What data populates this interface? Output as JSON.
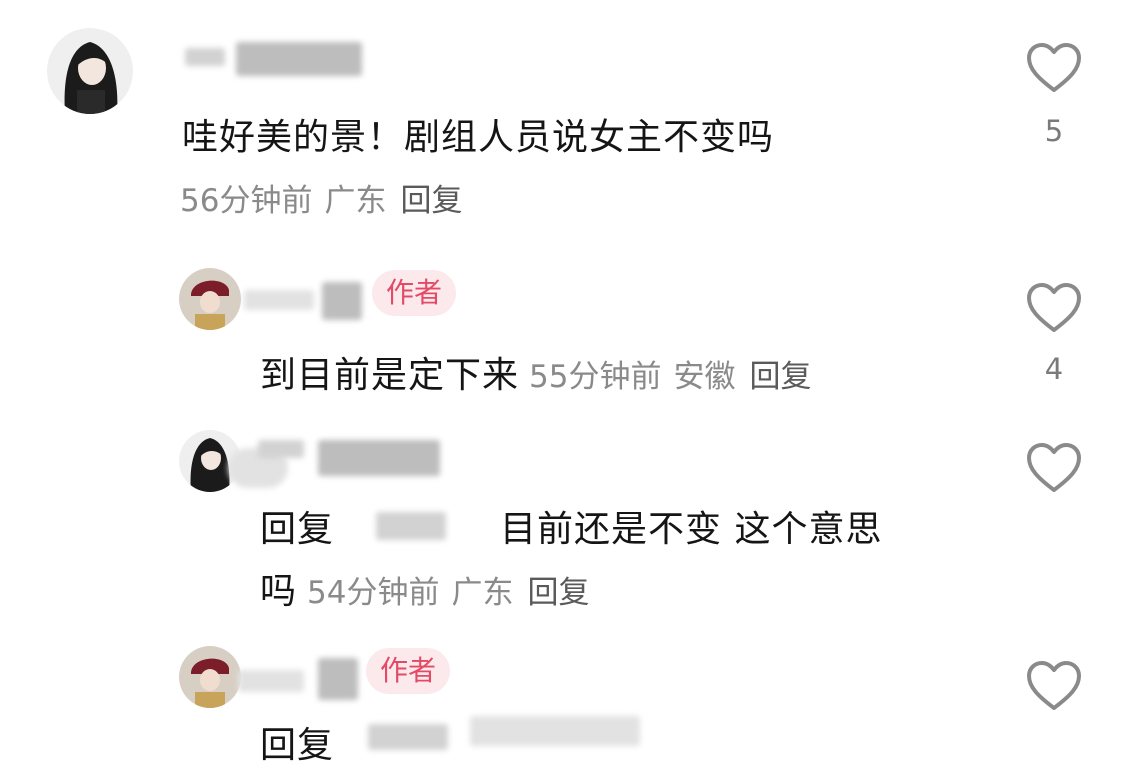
{
  "comments": [
    {
      "text": "哇好美的景！剧组人员说女主不变吗",
      "time": "56分钟前",
      "location": "广东",
      "reply_label": "回复",
      "likes": "5"
    },
    {
      "author_badge": "作者",
      "text": "到目前是定下来",
      "time": "55分钟前",
      "location": "安徽",
      "reply_label": "回复",
      "likes": "4"
    },
    {
      "reply_prefix": "回复",
      "text_line1": "目前还是不变 这个意思",
      "text_line2": "吗",
      "time": "54分钟前",
      "location": "广东",
      "reply_label": "回复"
    },
    {
      "author_badge": "作者",
      "reply_prefix": "回复"
    }
  ],
  "icons": {
    "like": "heart-outline-icon"
  },
  "colors": {
    "badge_text": "#e34a66",
    "badge_bg": "#fbe9ec",
    "meta": "#8a8a8a"
  }
}
